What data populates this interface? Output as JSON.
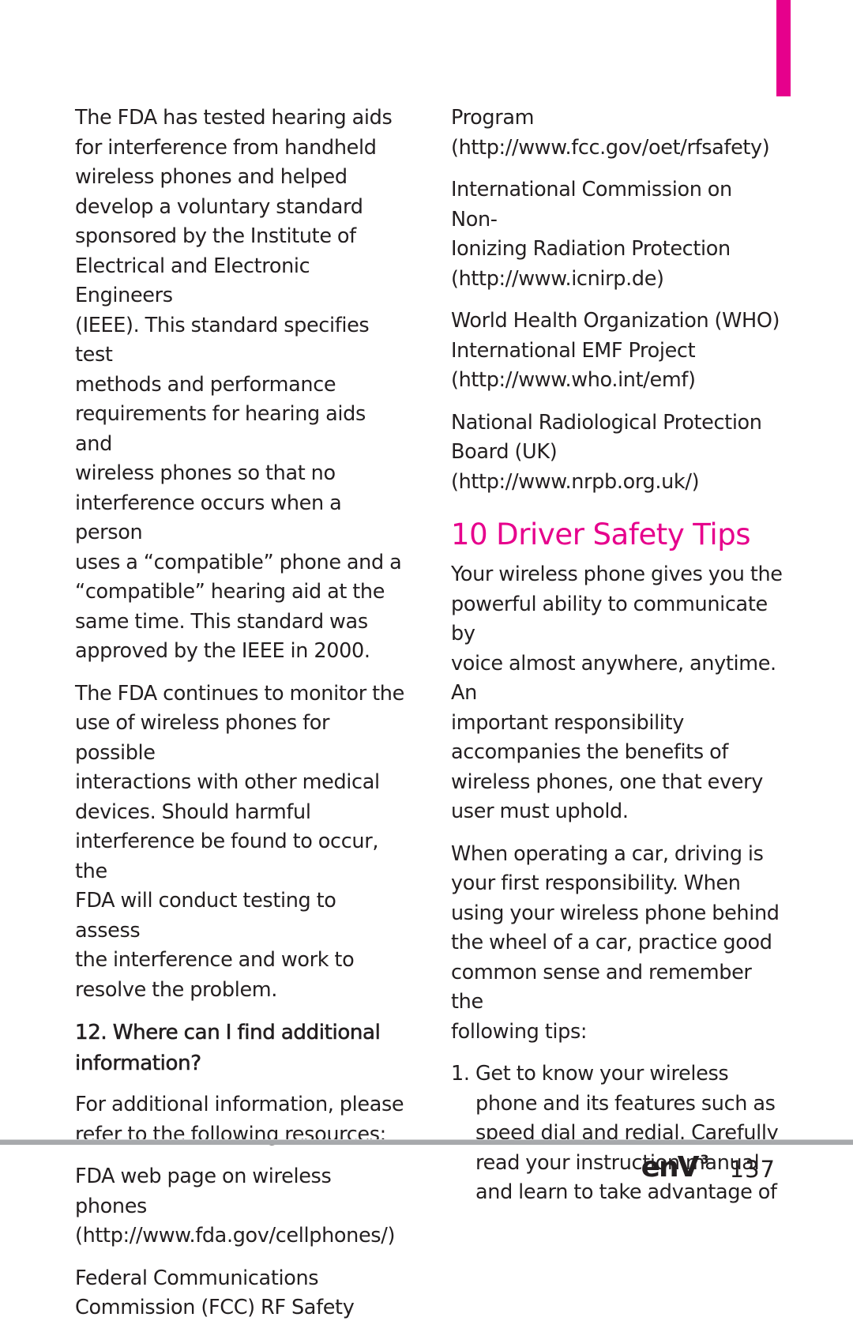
{
  "colors": {
    "accent": "#e6008c",
    "text": "#231f20",
    "rule": "#a7a9ac"
  },
  "left_column": {
    "paragraph_1": "The FDA has tested hearing aids\nfor interference from handheld\nwireless phones and helped\ndevelop a voluntary standard\nsponsored by the Institute of\nElectrical and Electronic Engineers\n(IEEE). This standard specifies test\nmethods and performance\nrequirements for hearing aids and\nwireless phones so that no\ninterference occurs when a person\nuses a “compatible” phone and a\n“compatible” hearing aid at the\nsame time. This standard was\napproved by the IEEE in 2000.",
    "paragraph_2": "The FDA continues to monitor the\nuse of wireless phones for possible\ninteractions with other medical\ndevices. Should harmful\ninterference be found to occur, the\nFDA will conduct testing to assess\nthe interference and work to\nresolve the problem.",
    "question_heading": "12. Where can I find additional\ninformation?",
    "paragraph_3": "For additional information, please\nrefer to the following resources:",
    "resource_1": "FDA web page on wireless phones\n(http://www.fda.gov/cellphones/)",
    "resource_2_start": "Federal Communications\nCommission (FCC) RF Safety"
  },
  "right_column": {
    "resource_2_end": "Program\n(http://www.fcc.gov/oet/rfsafety)",
    "resource_3": "International Commission on Non-\nIonizing Radiation Protection\n(http://www.icnirp.de)",
    "resource_4": "World Health Organization (WHO)\nInternational EMF Project\n(http://www.who.int/emf)",
    "resource_5": "National Radiological Protection\nBoard (UK)\n(http://www.nrpb.org.uk/)",
    "section_title": "10 Driver Safety Tips",
    "intro_1": "Your wireless phone gives you the\npowerful ability to communicate by\nvoice almost anywhere, anytime. An\nimportant responsibility\naccompanies the benefits of\nwireless phones, one that every\nuser must uphold.",
    "intro_2": "When operating a car, driving is\nyour first responsibility. When\nusing your wireless phone behind\nthe wheel of a car, practice good\ncommon sense and remember the\nfollowing tips:",
    "tips": [
      {
        "number": "1.",
        "text": "Get to know your wireless\nphone and its features such as\nspeed dial and redial. Carefully\nread your instruction manual\nand learn to take advantage of"
      }
    ]
  },
  "footer": {
    "logo_text": "enV",
    "logo_superscript": "3",
    "page_number": "137"
  }
}
